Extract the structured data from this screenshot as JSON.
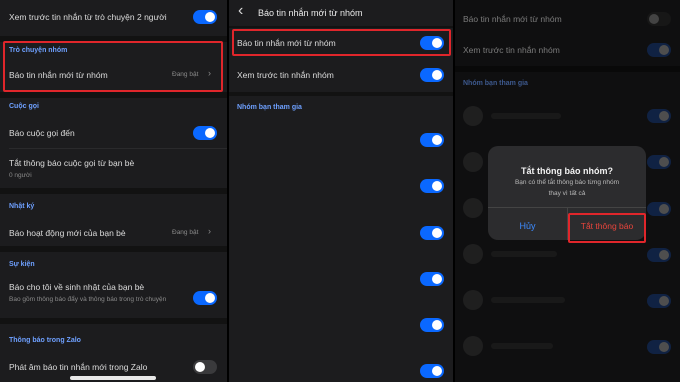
{
  "panel1": {
    "top_row_label": "Xem trước tin nhắn từ trò chuyện 2 người",
    "sections": [
      {
        "title": "Trò chuyện nhóm"
      },
      {
        "title": "Cuộc gọi"
      },
      {
        "title": "Nhật ký"
      },
      {
        "title": "Sự kiện"
      },
      {
        "title": "Thông báo trong Zalo"
      }
    ],
    "group_notify": {
      "label": "Báo tin nhắn mới từ nhóm",
      "value": "Đang bật"
    },
    "incoming_call": {
      "label": "Báo cuộc gọi đến"
    },
    "mute_calls_from_friends": {
      "label": "Tắt thông báo cuộc gọi từ bạn bè",
      "sub": "0 người"
    },
    "friends_activity": {
      "label": "Báo hoạt động mới của bạn bè",
      "value": "Đang bật"
    },
    "birthday": {
      "label": "Báo cho tôi về sinh nhật của bạn bè",
      "sub": "Bao gồm thông báo đẩy và thông báo trong trò chuyện"
    },
    "in_app_sound": {
      "label": "Phát âm báo tin nhắn mới trong Zalo"
    }
  },
  "panel2": {
    "header_title": "Báo tin nhắn mới từ nhóm",
    "rows": [
      {
        "label": "Báo tin nhắn mới từ nhóm"
      },
      {
        "label": "Xem trước tin nhắn nhóm"
      }
    ],
    "joined_groups_title": "Nhóm bạn tham gia"
  },
  "panel3": {
    "rows": [
      {
        "label": "Báo tin nhắn mới từ nhóm"
      },
      {
        "label": "Xem trước tin nhắn nhóm"
      }
    ],
    "joined_groups_title": "Nhóm bạn tham gia",
    "dialog": {
      "title": "Tắt thông báo nhóm?",
      "message_line1": "Bạn có thể tắt thông báo từng nhóm",
      "message_line2": "thay vì tất cả",
      "cancel_label": "Hủy",
      "confirm_label": "Tắt thông báo"
    }
  },
  "colors": {
    "accent": "#0a68ff",
    "highlight": "#e0262b",
    "section": "#6ea0ff"
  },
  "icons": {
    "chevron_right": "›",
    "back": "‹"
  }
}
